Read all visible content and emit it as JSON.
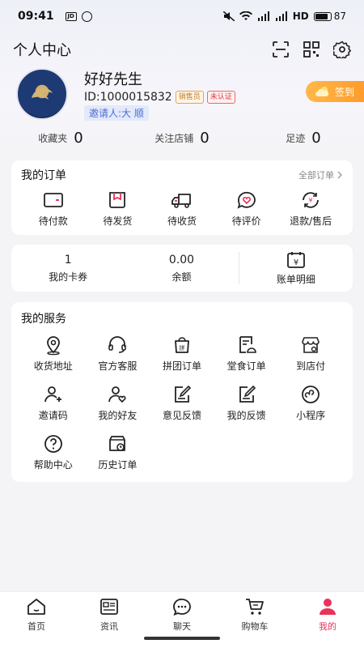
{
  "status_bar": {
    "time": "09:41",
    "battery": "87",
    "battery_level": 0.87,
    "network": "HD"
  },
  "header": {
    "title": "个人中心"
  },
  "profile": {
    "name": "好好先生",
    "uid": "ID:1000015832",
    "tag_role": "销售员",
    "tag_verify": "未认证",
    "inviter": "邀请人:大 顺",
    "signin_label": "签到"
  },
  "stats": [
    {
      "label": "收藏夹",
      "value": "0"
    },
    {
      "label": "关注店铺",
      "value": "0"
    },
    {
      "label": "足迹",
      "value": "0"
    }
  ],
  "orders": {
    "title": "我的订单",
    "more": "全部订单",
    "items": [
      "待付款",
      "待发货",
      "待收货",
      "待评价",
      "退款/售后"
    ]
  },
  "wallet": {
    "cards": {
      "value": "1",
      "label": "我的卡券"
    },
    "balance": {
      "value": "0.00",
      "label": "余额"
    },
    "bills": {
      "label": "账单明细"
    }
  },
  "services": {
    "title": "我的服务",
    "items": [
      "收货地址",
      "官方客服",
      "拼团订单",
      "堂食订单",
      "到店付",
      "邀请码",
      "我的好友",
      "意见反馈",
      "我的反馈",
      "小程序",
      "帮助中心",
      "历史订单"
    ]
  },
  "tabbar": {
    "items": [
      "首页",
      "资讯",
      "聊天",
      "购物车",
      "我的"
    ],
    "active_color": "#e8335b"
  }
}
